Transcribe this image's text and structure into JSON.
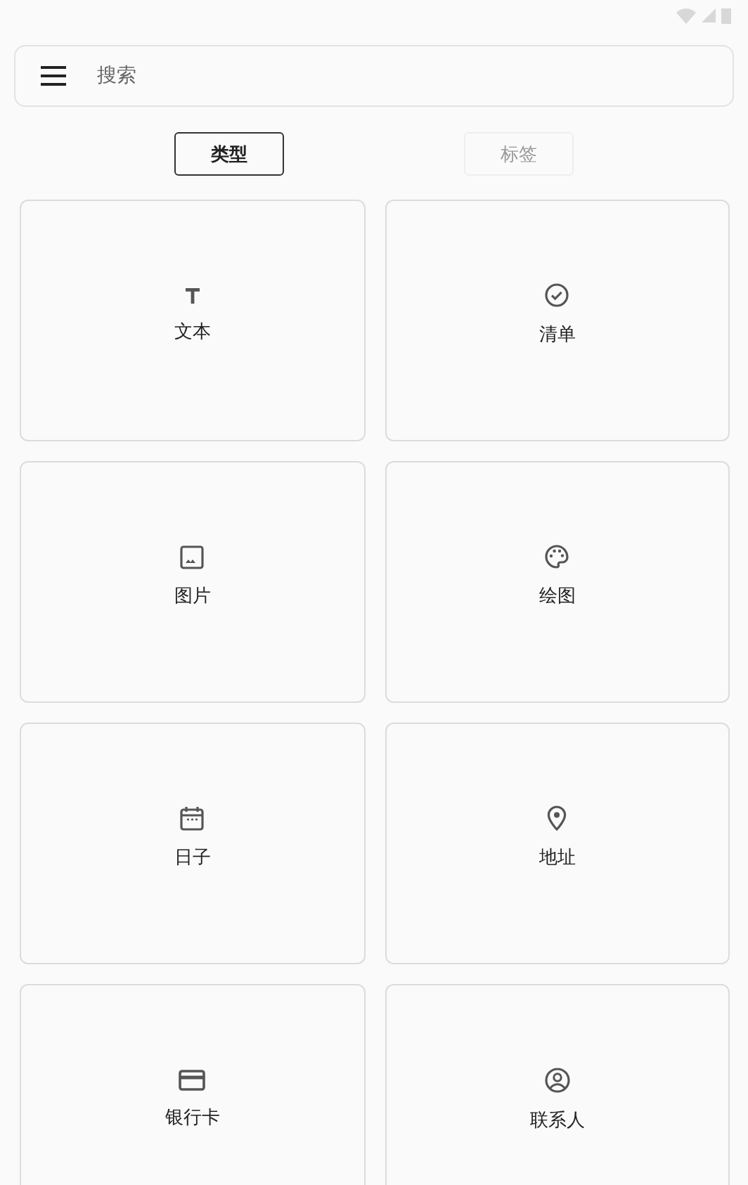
{
  "search": {
    "placeholder": "搜索"
  },
  "tabs": [
    {
      "label": "类型",
      "selected": true
    },
    {
      "label": "标签",
      "selected": false
    }
  ],
  "cards": [
    {
      "label": "文本"
    },
    {
      "label": "清单"
    },
    {
      "label": "图片"
    },
    {
      "label": "绘图"
    },
    {
      "label": "日子"
    },
    {
      "label": "地址"
    },
    {
      "label": "银行卡"
    },
    {
      "label": "联系人"
    }
  ]
}
